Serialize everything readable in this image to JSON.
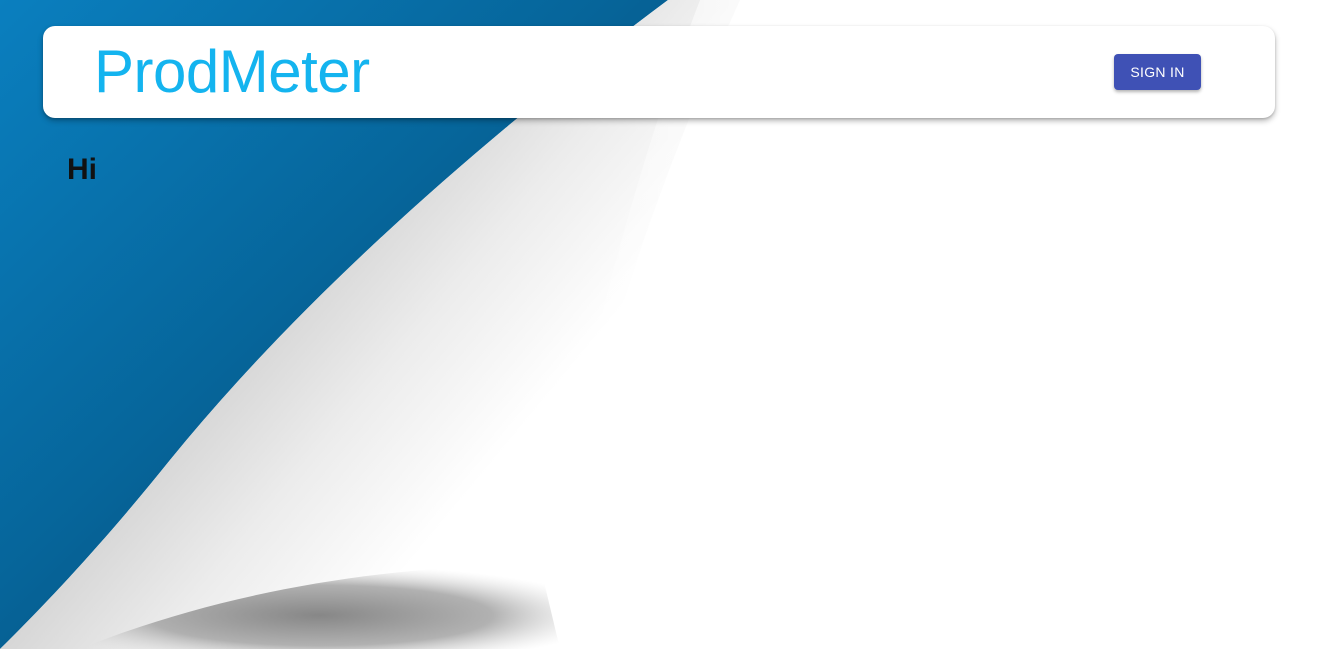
{
  "header": {
    "brand": "ProdMeter",
    "sign_in_label": "SIGN IN"
  },
  "main": {
    "greeting": "Hi"
  },
  "colors": {
    "brand": "#14b4ef",
    "primary_button": "#3f51b5",
    "background_blue": "#0670a8"
  }
}
